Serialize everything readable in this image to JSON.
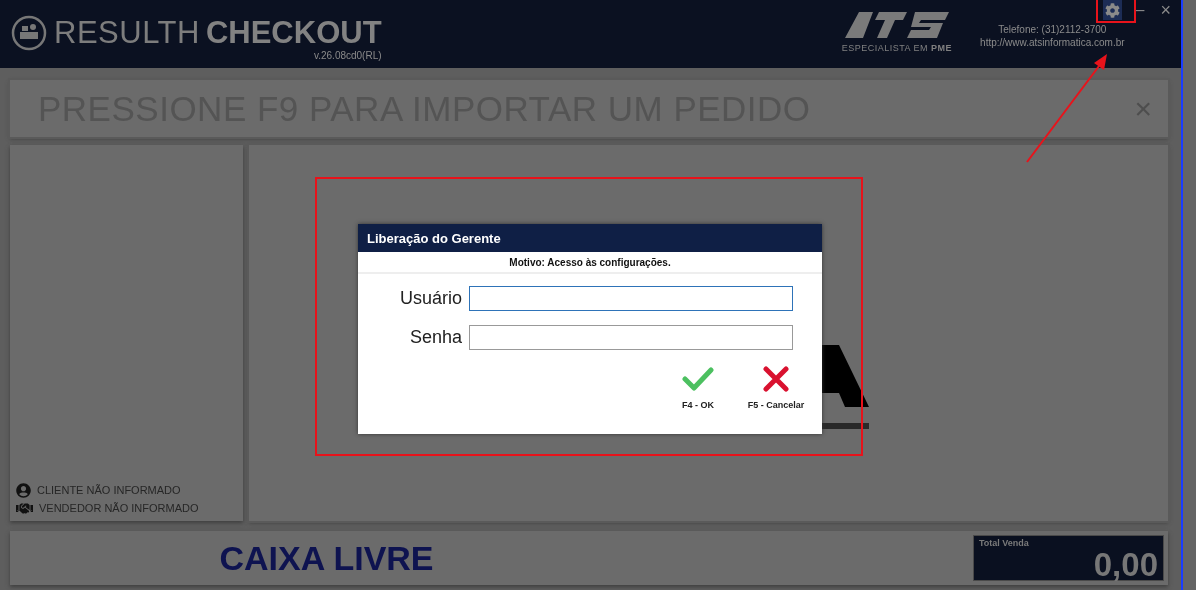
{
  "header": {
    "brand_light": "RESULTH",
    "brand_bold": "CHECKOUT",
    "version": "v.26.08cd0(RL)",
    "partner_tagline": "ESPECIALISTA EM **PME**",
    "phone": "Telefone: (31)2112-3700",
    "website": "http://www.atsinformatica.com.br",
    "window_controls": [
      {
        "kind": "settings",
        "highlighted": true
      },
      {
        "kind": "minimize",
        "label": "–"
      },
      {
        "kind": "close",
        "label": "×"
      }
    ]
  },
  "prompt_bar": {
    "text": "PRESSIONE F9 PARA IMPORTAR UM PEDIDO",
    "close": "×"
  },
  "customer_info": [
    {
      "kind": "client",
      "text": "CLIENTE NÃO INFORMADO"
    },
    {
      "kind": "seller",
      "text": "VENDEDOR NÃO INFORMADO"
    }
  ],
  "status": "CAIXA LIVRE",
  "total": {
    "label": "Total Venda",
    "value": "0,00"
  },
  "dialog": {
    "title": "Liberação do Gerente",
    "reason": "Motivo: Acesso às configurações.",
    "fields": [
      {
        "label": "Usuário",
        "focused": true
      },
      {
        "label": "Senha",
        "focused": false
      }
    ],
    "buttons": [
      {
        "kind": "ok",
        "label": "F4 - OK"
      },
      {
        "kind": "cancel",
        "label": "F5 - Cancelar"
      }
    ]
  }
}
